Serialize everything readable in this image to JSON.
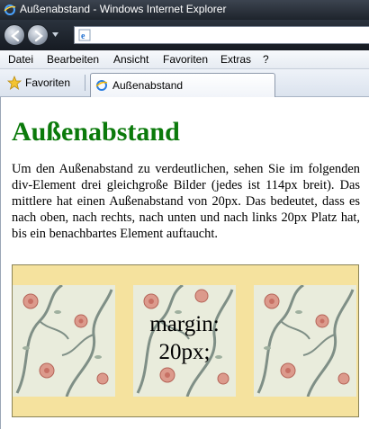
{
  "window": {
    "title": "Außenabstand - Windows Internet Explorer"
  },
  "address_bar": {
    "url": ""
  },
  "menu": {
    "items": [
      "Datei",
      "Bearbeiten",
      "Ansicht",
      "Favoriten",
      "Extras",
      "?"
    ]
  },
  "favorites_bar": {
    "favorites_label": "Favoriten",
    "tab_label": "Außenabstand"
  },
  "page": {
    "heading": "Außenabstand",
    "paragraph": "Um den Außenabstand zu verdeutlichen, sehen Sie im folgenden div-Element drei gleichgroße Bilder (jedes ist 114px breit). Das mittlere hat einen Außenabstand von 20px. Das bedeutet, dass es nach oben, nach rechts, nach unten und nach links 20px Platz hat, bis ein benachbartes Element auftaucht.",
    "caption_line1": "margin:",
    "caption_line2": "20px;",
    "heading_color": "#0b7a0b",
    "demo_background": "#f5e29e"
  },
  "icons": {
    "app": "ie-logo-icon",
    "back": "back-arrow-icon",
    "forward": "forward-arrow-icon",
    "favorites": "star-icon",
    "tab": "ie-page-icon"
  }
}
